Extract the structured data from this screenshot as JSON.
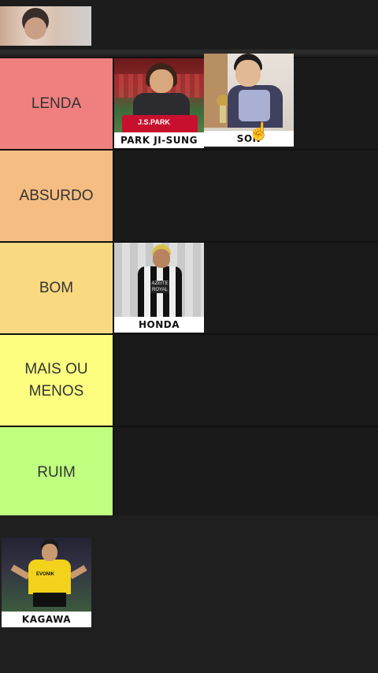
{
  "top_thumbnail": {
    "icon": "person-photo"
  },
  "tiers": [
    {
      "label": "LENDA",
      "color": "#f08080"
    },
    {
      "label": "ABSURDO",
      "color": "#f5bd82"
    },
    {
      "label": "BOM",
      "color": "#fada80"
    },
    {
      "label": "MAIS OU\nMENOS",
      "color": "#fdfd7f"
    },
    {
      "label": "RUIM",
      "color": "#bffe7f"
    }
  ],
  "cards": {
    "park": {
      "name": "PARK JI-SUNG",
      "shirt_text": "J.S.PARK"
    },
    "son": {
      "name": "SON"
    },
    "honda": {
      "name": "HONDA",
      "badge_text": "AZEITE ROYAL"
    },
    "kagawa": {
      "name": "KAGAWA",
      "shirt_text": "EVONIK"
    }
  },
  "cursor": {
    "icon": "hand-pointer-icon"
  }
}
